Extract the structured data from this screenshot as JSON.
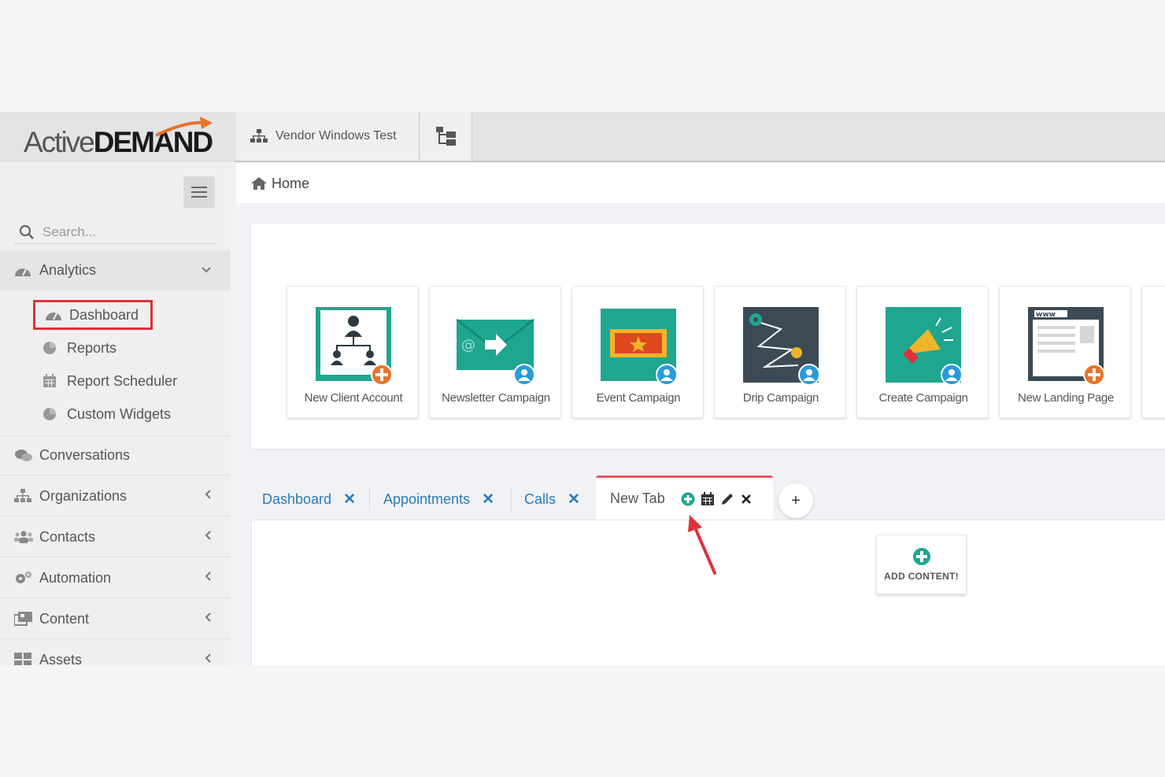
{
  "header": {
    "brand_light": "Active",
    "brand_bold": "DEMAND",
    "org_name": "Vendor Windows Test"
  },
  "sidebar": {
    "search_placeholder": "Search...",
    "analytics_label": "Analytics",
    "sub_items": [
      "Dashboard",
      "Reports",
      "Report Scheduler",
      "Custom Widgets"
    ],
    "items": [
      "Conversations",
      "Organizations",
      "Contacts",
      "Automation",
      "Content",
      "Assets"
    ]
  },
  "breadcrumb": {
    "home": "Home"
  },
  "quick_actions": [
    {
      "label": "New Client Account",
      "icon": "client-account-icon"
    },
    {
      "label": "Newsletter Campaign",
      "icon": "newsletter-icon"
    },
    {
      "label": "Event Campaign",
      "icon": "event-ticket-icon"
    },
    {
      "label": "Drip Campaign",
      "icon": "drip-path-icon"
    },
    {
      "label": "Create Campaign",
      "icon": "megaphone-icon"
    },
    {
      "label": "New Landing Page",
      "icon": "landing-page-icon"
    }
  ],
  "dashboard_tabs": {
    "tabs": [
      "Dashboard",
      "Appointments",
      "Calls"
    ],
    "active_tab": "New Tab",
    "add_tab_label": "+",
    "add_content_label": "ADD CONTENT!"
  },
  "colors": {
    "teal": "#1fa68f",
    "orange": "#e8732a",
    "link_blue": "#2a7ab8",
    "highlight_red": "#e0313b",
    "dark_slate": "#3b4a55"
  }
}
